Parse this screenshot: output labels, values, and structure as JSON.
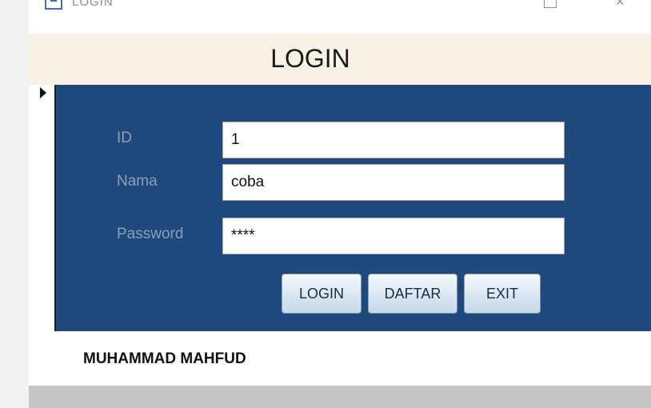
{
  "window": {
    "title": "LOGIN",
    "close_glyph": "×"
  },
  "form": {
    "header_title": "LOGIN",
    "fields": [
      {
        "label": "ID",
        "value": "1"
      },
      {
        "label": "Nama",
        "value": "coba"
      },
      {
        "label": "Password",
        "value": "****"
      }
    ],
    "buttons": {
      "login": "LOGIN",
      "daftar": "DAFTAR",
      "exit": "EXIT"
    },
    "footer_name": "MUHAMMAD MAHFUD"
  },
  "colors": {
    "header_bg": "#f8f1e6",
    "detail_bg": "#1f497d",
    "label_text": "#8d9fb9",
    "status_bg": "#c6c6c6"
  },
  "icons": {
    "app": "form-icon",
    "maximize": "maximize-icon",
    "close": "close-icon",
    "record_selector": "record-pointer-icon"
  }
}
